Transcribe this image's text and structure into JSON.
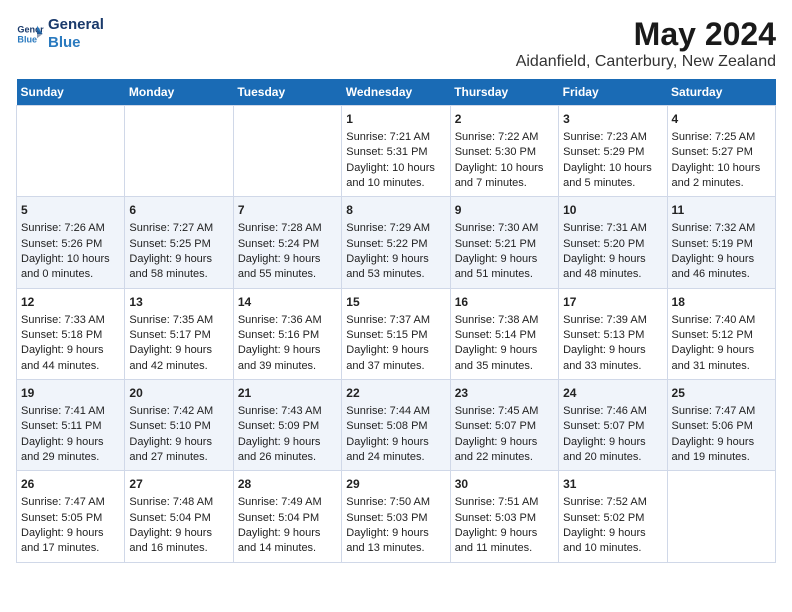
{
  "logo": {
    "line1": "General",
    "line2": "Blue"
  },
  "title": "May 2024",
  "subtitle": "Aidanfield, Canterbury, New Zealand",
  "days_of_week": [
    "Sunday",
    "Monday",
    "Tuesday",
    "Wednesday",
    "Thursday",
    "Friday",
    "Saturday"
  ],
  "weeks": [
    [
      {
        "day": "",
        "content": ""
      },
      {
        "day": "",
        "content": ""
      },
      {
        "day": "",
        "content": ""
      },
      {
        "day": "1",
        "content": "Sunrise: 7:21 AM\nSunset: 5:31 PM\nDaylight: 10 hours and 10 minutes."
      },
      {
        "day": "2",
        "content": "Sunrise: 7:22 AM\nSunset: 5:30 PM\nDaylight: 10 hours and 7 minutes."
      },
      {
        "day": "3",
        "content": "Sunrise: 7:23 AM\nSunset: 5:29 PM\nDaylight: 10 hours and 5 minutes."
      },
      {
        "day": "4",
        "content": "Sunrise: 7:25 AM\nSunset: 5:27 PM\nDaylight: 10 hours and 2 minutes."
      }
    ],
    [
      {
        "day": "5",
        "content": "Sunrise: 7:26 AM\nSunset: 5:26 PM\nDaylight: 10 hours and 0 minutes."
      },
      {
        "day": "6",
        "content": "Sunrise: 7:27 AM\nSunset: 5:25 PM\nDaylight: 9 hours and 58 minutes."
      },
      {
        "day": "7",
        "content": "Sunrise: 7:28 AM\nSunset: 5:24 PM\nDaylight: 9 hours and 55 minutes."
      },
      {
        "day": "8",
        "content": "Sunrise: 7:29 AM\nSunset: 5:22 PM\nDaylight: 9 hours and 53 minutes."
      },
      {
        "day": "9",
        "content": "Sunrise: 7:30 AM\nSunset: 5:21 PM\nDaylight: 9 hours and 51 minutes."
      },
      {
        "day": "10",
        "content": "Sunrise: 7:31 AM\nSunset: 5:20 PM\nDaylight: 9 hours and 48 minutes."
      },
      {
        "day": "11",
        "content": "Sunrise: 7:32 AM\nSunset: 5:19 PM\nDaylight: 9 hours and 46 minutes."
      }
    ],
    [
      {
        "day": "12",
        "content": "Sunrise: 7:33 AM\nSunset: 5:18 PM\nDaylight: 9 hours and 44 minutes."
      },
      {
        "day": "13",
        "content": "Sunrise: 7:35 AM\nSunset: 5:17 PM\nDaylight: 9 hours and 42 minutes."
      },
      {
        "day": "14",
        "content": "Sunrise: 7:36 AM\nSunset: 5:16 PM\nDaylight: 9 hours and 39 minutes."
      },
      {
        "day": "15",
        "content": "Sunrise: 7:37 AM\nSunset: 5:15 PM\nDaylight: 9 hours and 37 minutes."
      },
      {
        "day": "16",
        "content": "Sunrise: 7:38 AM\nSunset: 5:14 PM\nDaylight: 9 hours and 35 minutes."
      },
      {
        "day": "17",
        "content": "Sunrise: 7:39 AM\nSunset: 5:13 PM\nDaylight: 9 hours and 33 minutes."
      },
      {
        "day": "18",
        "content": "Sunrise: 7:40 AM\nSunset: 5:12 PM\nDaylight: 9 hours and 31 minutes."
      }
    ],
    [
      {
        "day": "19",
        "content": "Sunrise: 7:41 AM\nSunset: 5:11 PM\nDaylight: 9 hours and 29 minutes."
      },
      {
        "day": "20",
        "content": "Sunrise: 7:42 AM\nSunset: 5:10 PM\nDaylight: 9 hours and 27 minutes."
      },
      {
        "day": "21",
        "content": "Sunrise: 7:43 AM\nSunset: 5:09 PM\nDaylight: 9 hours and 26 minutes."
      },
      {
        "day": "22",
        "content": "Sunrise: 7:44 AM\nSunset: 5:08 PM\nDaylight: 9 hours and 24 minutes."
      },
      {
        "day": "23",
        "content": "Sunrise: 7:45 AM\nSunset: 5:07 PM\nDaylight: 9 hours and 22 minutes."
      },
      {
        "day": "24",
        "content": "Sunrise: 7:46 AM\nSunset: 5:07 PM\nDaylight: 9 hours and 20 minutes."
      },
      {
        "day": "25",
        "content": "Sunrise: 7:47 AM\nSunset: 5:06 PM\nDaylight: 9 hours and 19 minutes."
      }
    ],
    [
      {
        "day": "26",
        "content": "Sunrise: 7:47 AM\nSunset: 5:05 PM\nDaylight: 9 hours and 17 minutes."
      },
      {
        "day": "27",
        "content": "Sunrise: 7:48 AM\nSunset: 5:04 PM\nDaylight: 9 hours and 16 minutes."
      },
      {
        "day": "28",
        "content": "Sunrise: 7:49 AM\nSunset: 5:04 PM\nDaylight: 9 hours and 14 minutes."
      },
      {
        "day": "29",
        "content": "Sunrise: 7:50 AM\nSunset: 5:03 PM\nDaylight: 9 hours and 13 minutes."
      },
      {
        "day": "30",
        "content": "Sunrise: 7:51 AM\nSunset: 5:03 PM\nDaylight: 9 hours and 11 minutes."
      },
      {
        "day": "31",
        "content": "Sunrise: 7:52 AM\nSunset: 5:02 PM\nDaylight: 9 hours and 10 minutes."
      },
      {
        "day": "",
        "content": ""
      }
    ]
  ]
}
